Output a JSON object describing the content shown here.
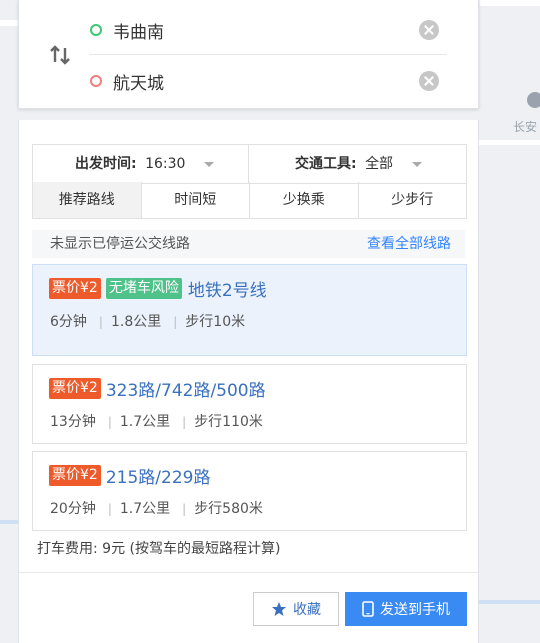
{
  "route": {
    "start": "韦曲南",
    "end": "航天城"
  },
  "map": {
    "label_place": "长安"
  },
  "filters": {
    "depart_label": "出发时间:",
    "depart_value": "16:30",
    "transport_label": "交通工具:",
    "transport_value": "全部"
  },
  "tabs": [
    "推荐路线",
    "时间短",
    "少换乘",
    "少步行"
  ],
  "notice": {
    "message": "未显示已停运公交线路",
    "link": "查看全部线路"
  },
  "results": [
    {
      "price": "票价¥2",
      "tag": "无堵车风险",
      "lines": "地铁2号线",
      "duration": "6分钟",
      "distance": "1.8公里",
      "walk": "步行10米"
    },
    {
      "price": "票价¥2",
      "lines": "323路/742路/500路",
      "duration": "13分钟",
      "distance": "1.7公里",
      "walk": "步行110米"
    },
    {
      "price": "票价¥2",
      "lines": "215路/229路",
      "duration": "20分钟",
      "distance": "1.7公里",
      "walk": "步行580米"
    }
  ],
  "taxi": "打车费用: 9元 (按驾车的最短路程计算)",
  "buttons": {
    "favorite": "收藏",
    "send": "发送到手机"
  },
  "colors": {
    "accent": "#3a8af3",
    "price_badge": "#ef5a2a",
    "safe_badge": "#4fc28a",
    "selected_row": "#ebf2fc"
  }
}
